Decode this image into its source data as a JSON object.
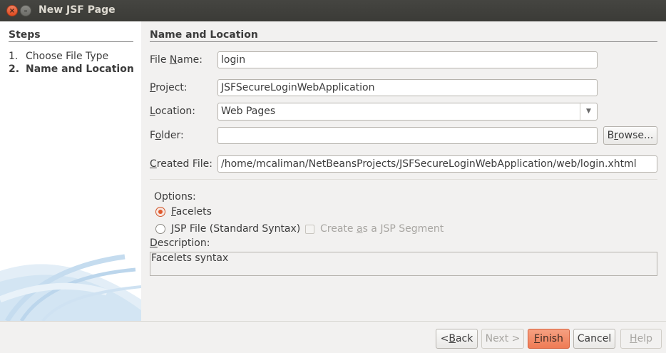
{
  "window": {
    "title": "New JSF Page",
    "close_glyph": "×",
    "minimize_glyph": "–"
  },
  "steps": {
    "title": "Steps",
    "items": [
      {
        "num": "1.",
        "label": "Choose File Type"
      },
      {
        "num": "2.",
        "label": "Name and Location"
      }
    ]
  },
  "form": {
    "section_title": "Name and Location",
    "file_name": {
      "label_pre": "File ",
      "label_u": "N",
      "label_post": "ame:",
      "value": "login"
    },
    "project": {
      "label_pre": "",
      "label_u": "P",
      "label_post": "roject:",
      "value": "JSFSecureLoginWebApplication"
    },
    "location": {
      "label_pre": "",
      "label_u": "L",
      "label_post": "ocation:",
      "value": "Web Pages"
    },
    "folder": {
      "label_pre": "F",
      "label_u": "o",
      "label_post": "lder:",
      "value": ""
    },
    "browse": {
      "label_pre": "B",
      "label_u": "r",
      "label_post": "owse..."
    },
    "created_file": {
      "label_pre": "",
      "label_u": "C",
      "label_post": "reated File:",
      "value": "/home/mcaliman/NetBeansProjects/JSFSecureLoginWebApplication/web/login.xhtml"
    },
    "options_label": "Options:",
    "facelets": {
      "label_pre": "",
      "label_u": "F",
      "label_post": "acelets",
      "selected": true
    },
    "jsp": {
      "label_pre": "",
      "label_u": "J",
      "label_post": "SP File (Standard Syntax)",
      "selected": false
    },
    "jsp_segment": {
      "label_pre": "Create ",
      "label_u": "a",
      "label_post": "s a JSP Segment",
      "checked": false,
      "enabled": false
    },
    "description_label": {
      "label_pre": "",
      "label_u": "D",
      "label_post": "escription:"
    },
    "description_text": "Facelets syntax"
  },
  "buttons": {
    "back": {
      "pre": "< ",
      "u": "B",
      "post": "ack",
      "enabled": true
    },
    "next": {
      "pre": "Next >",
      "u": "",
      "post": "",
      "enabled": false
    },
    "finish": {
      "pre": "",
      "u": "F",
      "post": "inish",
      "enabled": true
    },
    "cancel": {
      "pre": "Cancel",
      "u": "",
      "post": "",
      "enabled": true
    },
    "help": {
      "pre": "",
      "u": "H",
      "post": "elp",
      "enabled": false
    }
  },
  "colors": {
    "accent": "#ef7b55",
    "titlebar": "#3b3b37",
    "radio_selected": "#e0592c"
  },
  "icons": {
    "location_dropdown": "chevron-down-icon",
    "close": "close-icon",
    "minimize": "minimize-icon"
  }
}
